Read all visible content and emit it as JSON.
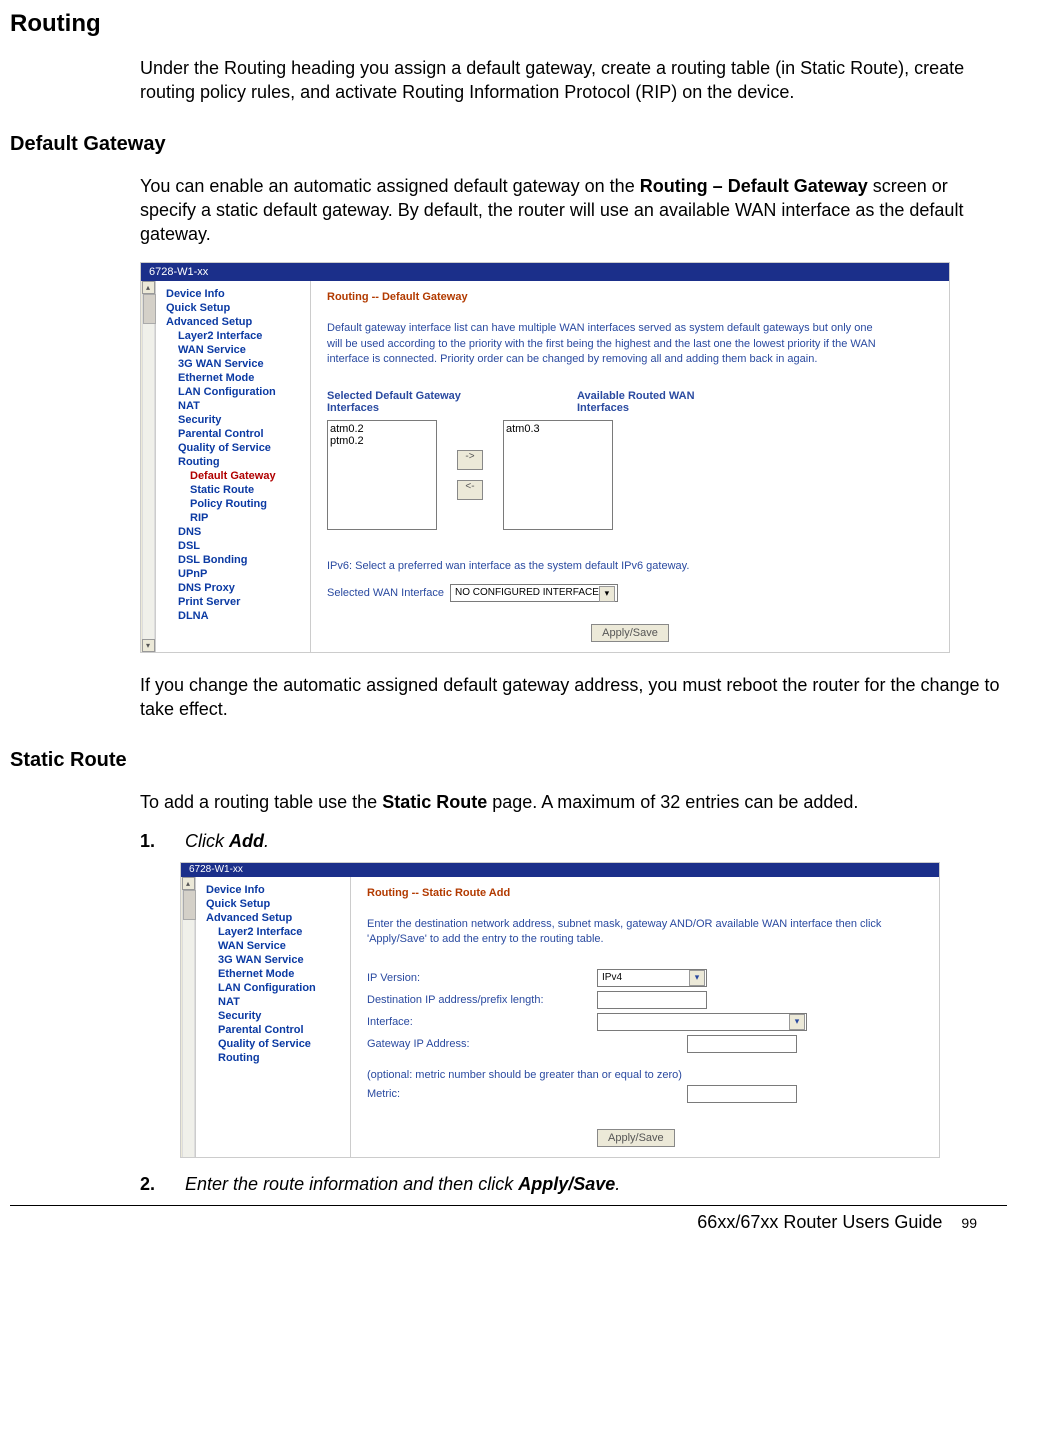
{
  "headings": {
    "routing": "Routing",
    "default_gateway": "Default Gateway",
    "static_route": "Static Route"
  },
  "paragraphs": {
    "routing_intro": "Under the Routing heading you assign a default gateway, create a routing table (in Static Route), create routing policy rules, and activate Routing Information Protocol (RIP) on the device.",
    "dg_intro_pre": "You can enable an automatic assigned default gateway on the ",
    "dg_intro_bold": "Routing – Default Gateway",
    "dg_intro_post": " screen or specify a static default gateway. By default, the router will use an available WAN interface as the default gateway.",
    "dg_reboot": "If you change the automatic assigned default gateway address, you must reboot the router for the change to take effect.",
    "sr_intro_pre": "To add a routing table use the ",
    "sr_intro_bold": "Static Route",
    "sr_intro_post": " page. A maximum of 32 entries can be added."
  },
  "steps": {
    "s1_num": "1.",
    "s1_pre": "Click ",
    "s1_bold": "Add",
    "s1_post": ".",
    "s2_num": "2.",
    "s2_pre": "Enter the route information and then click ",
    "s2_bold": "Apply/Save",
    "s2_post": "."
  },
  "embed1": {
    "title": "6728-W1-xx",
    "sidebar": {
      "items": [
        {
          "label": "Device Info",
          "cls": ""
        },
        {
          "label": "Quick Setup",
          "cls": ""
        },
        {
          "label": "Advanced Setup",
          "cls": ""
        },
        {
          "label": "Layer2 Interface",
          "cls": "sub1"
        },
        {
          "label": "WAN Service",
          "cls": "sub1"
        },
        {
          "label": "3G WAN Service",
          "cls": "sub1"
        },
        {
          "label": "Ethernet Mode",
          "cls": "sub1"
        },
        {
          "label": "LAN Configuration",
          "cls": "sub1"
        },
        {
          "label": "NAT",
          "cls": "sub1"
        },
        {
          "label": "Security",
          "cls": "sub1"
        },
        {
          "label": "Parental Control",
          "cls": "sub1"
        },
        {
          "label": "Quality of Service",
          "cls": "sub1"
        },
        {
          "label": "Routing",
          "cls": "sub1"
        },
        {
          "label": "Default Gateway",
          "cls": "sub2 active"
        },
        {
          "label": "Static Route",
          "cls": "sub2"
        },
        {
          "label": "Policy Routing",
          "cls": "sub2"
        },
        {
          "label": "RIP",
          "cls": "sub2"
        },
        {
          "label": "DNS",
          "cls": "sub1"
        },
        {
          "label": "DSL",
          "cls": "sub1"
        },
        {
          "label": "DSL Bonding",
          "cls": "sub1"
        },
        {
          "label": "UPnP",
          "cls": "sub1"
        },
        {
          "label": "DNS Proxy",
          "cls": "sub1"
        },
        {
          "label": "Print Server",
          "cls": "sub1"
        },
        {
          "label": "DLNA",
          "cls": "sub1"
        }
      ]
    },
    "content": {
      "title": "Routing -- Default Gateway",
      "description": "Default gateway interface list can have multiple WAN interfaces served as system default gateways but only one will be used according to the priority with the first being the highest and the last one the lowest priority if the WAN interface is connected. Priority order can be changed by removing all and adding them back in again.",
      "col1_label": "Selected Default Gateway Interfaces",
      "col2_label": "Available Routed WAN Interfaces",
      "list1": "atm0.2\nptm0.2",
      "list2": "atm0.3",
      "btn_right": "->",
      "btn_left": "<-",
      "ipv6_line": "IPv6: Select a preferred wan interface as the system default IPv6 gateway.",
      "sel_wan_label": "Selected WAN Interface",
      "sel_wan_value": "NO CONFIGURED INTERFACE",
      "apply": "Apply/Save"
    }
  },
  "embed2": {
    "title": "6728-W1-xx",
    "sidebar": {
      "items": [
        {
          "label": "Device Info",
          "cls": ""
        },
        {
          "label": "Quick Setup",
          "cls": ""
        },
        {
          "label": "Advanced Setup",
          "cls": ""
        },
        {
          "label": "Layer2 Interface",
          "cls": "sub1"
        },
        {
          "label": "WAN Service",
          "cls": "sub1"
        },
        {
          "label": "3G WAN Service",
          "cls": "sub1"
        },
        {
          "label": "Ethernet Mode",
          "cls": "sub1"
        },
        {
          "label": "LAN Configuration",
          "cls": "sub1"
        },
        {
          "label": "NAT",
          "cls": "sub1"
        },
        {
          "label": "Security",
          "cls": "sub1"
        },
        {
          "label": "Parental Control",
          "cls": "sub1"
        },
        {
          "label": "Quality of Service",
          "cls": "sub1"
        },
        {
          "label": "Routing",
          "cls": "sub1"
        }
      ]
    },
    "content": {
      "title": "Routing -- Static Route Add",
      "description": "Enter the destination network address, subnet mask, gateway AND/OR available WAN interface then click 'Apply/Save' to add the entry to the routing table.",
      "ipversion_label": "IP Version:",
      "ipversion_value": "IPv4",
      "dest_label": "Destination IP address/prefix length:",
      "iface_label": "Interface:",
      "gw_label": "Gateway IP Address:",
      "optional": "(optional: metric number should be greater than or equal to zero)",
      "metric_label": "Metric:",
      "apply": "Apply/Save"
    }
  },
  "footer": {
    "guide": "66xx/67xx Router Users Guide",
    "page": "99"
  }
}
